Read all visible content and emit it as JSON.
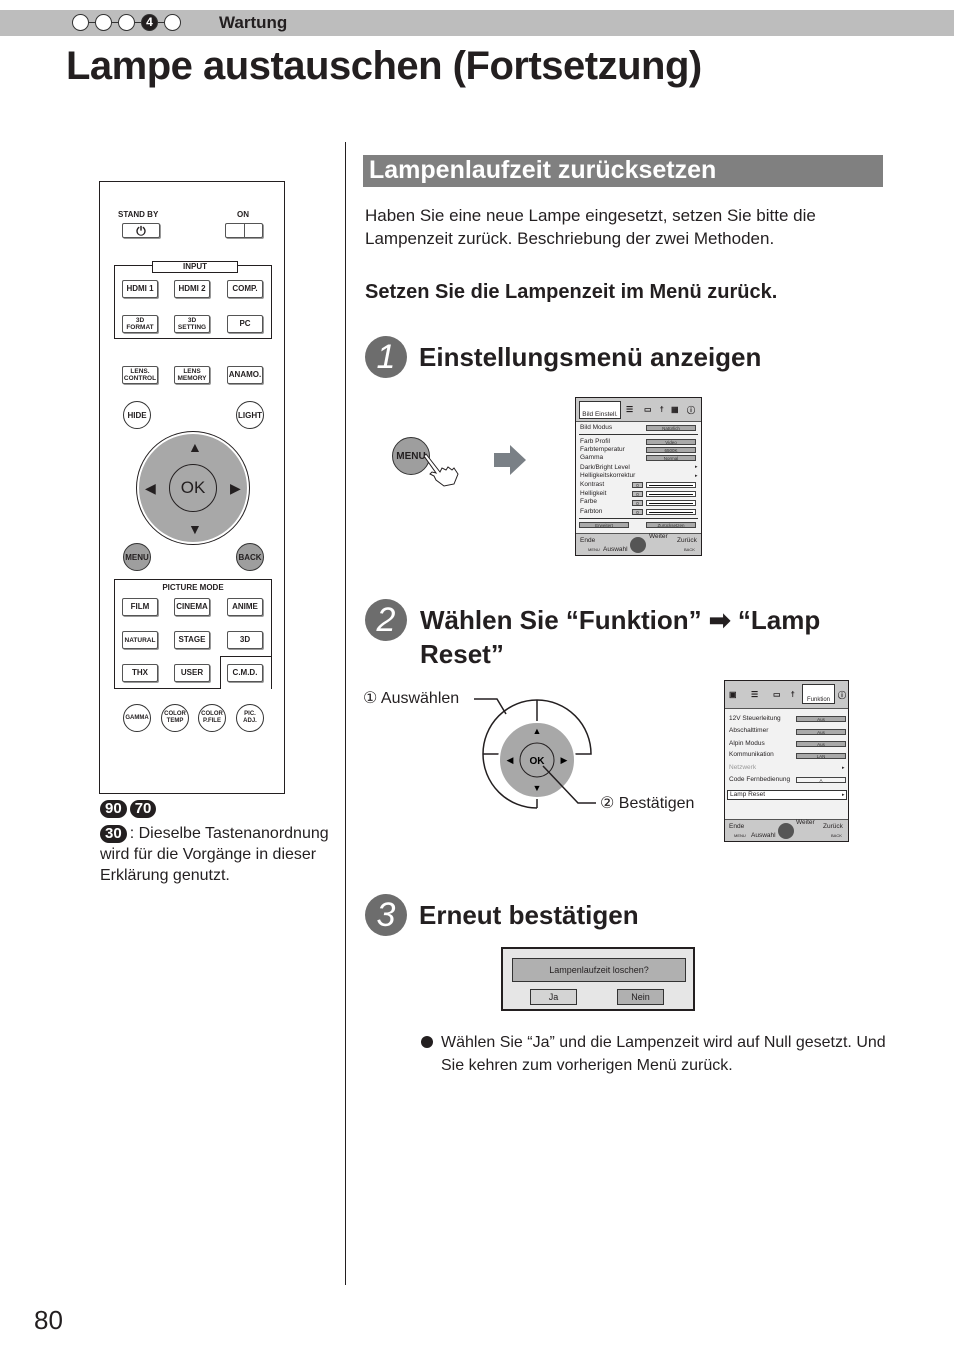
{
  "header": {
    "chapter_steps": [
      "",
      "",
      "",
      "4",
      ""
    ],
    "active_step": 4,
    "chapter_label": "Wartung",
    "page_title": "Lampe austauschen (Fortsetzung)"
  },
  "remote": {
    "standby_label": "STAND BY",
    "on_label": "ON",
    "input_group_label": "INPUT",
    "input_buttons": [
      "HDMI 1",
      "HDMI 2",
      "COMP.",
      "PC"
    ],
    "threed_format": [
      "3D",
      "FORMAT"
    ],
    "threed_setting": [
      "3D",
      "SETTING"
    ],
    "lens_control": [
      "LENS.",
      "CONTROL"
    ],
    "lens_memory": [
      "LENS",
      "MEMORY"
    ],
    "anamo": "ANAMO.",
    "hide": "HIDE",
    "light": "LIGHT",
    "ok": "OK",
    "menu": "MENU",
    "back": "BACK",
    "picture_mode_label": "PICTURE MODE",
    "picture_mode_buttons": [
      "FILM",
      "CINEMA",
      "ANIME",
      "NATURAL",
      "STAGE",
      "3D",
      "THX",
      "USER",
      "C.M.D."
    ],
    "round_buttons": [
      [
        "GAMMA",
        ""
      ],
      [
        "COLOR",
        "TEMP"
      ],
      [
        "COLOR",
        "P.FILE"
      ],
      [
        "PIC.",
        "ADJ."
      ]
    ]
  },
  "note": {
    "badges": [
      "90",
      "70",
      "30"
    ],
    "text": ": Dieselbe Tastenanordnung wird für die Vorgänge in dieser Erklärung genutzt."
  },
  "section": {
    "heading": "Lampenlaufzeit zurücksetzen",
    "intro": "Haben Sie eine neue Lampe eingesetzt, setzen Sie bitte die Lampenzeit zurück. Beschriebung der zwei Methoden.",
    "subheading": "Setzen Sie die Lampenzeit im Menü zurück."
  },
  "steps": [
    {
      "number": "1",
      "title": "Einstellungsmenü anzeigen"
    },
    {
      "number": "2",
      "title": "Wählen Sie “Funktion” ➡ “Lamp Reset”"
    },
    {
      "number": "3",
      "title": "Erneut bestätigen"
    }
  ],
  "step1": {
    "menu_button": "MENU",
    "osd": {
      "active_tab": "Bild Einstell.",
      "rows": [
        {
          "label": "Bild Modus",
          "value": "Natürlich"
        },
        {
          "label": "Farb Profil",
          "value": "Video"
        },
        {
          "label": "Farbtemperatur",
          "value": "6500K"
        },
        {
          "label": "Gamma",
          "value": "Normal"
        },
        {
          "label": "Dark/Bright Level",
          "value": "▸"
        },
        {
          "label": "Helligkeitskorrektur",
          "value": "▸"
        },
        {
          "label": "Kontrast",
          "value": "0"
        },
        {
          "label": "Helligkeit",
          "value": "0"
        },
        {
          "label": "Farbe",
          "value": "0"
        },
        {
          "label": "Farbton",
          "value": "0"
        }
      ],
      "buttons": [
        "Erweitert",
        "Zurücksetzen"
      ],
      "footer": {
        "end": "Ende",
        "end_key": "MENU",
        "select": "Auswahl",
        "next": "Weiter",
        "back": "Zurück",
        "back_key": "BACK"
      }
    }
  },
  "step2": {
    "select_label": "① Auswählen",
    "confirm_label": "② Bestätigen",
    "ok": "OK",
    "osd": {
      "active_tab": "Funktion",
      "rows": [
        {
          "label": "12V Steuerleitung",
          "value": "Aus"
        },
        {
          "label": "Abschalttimer",
          "value": "Aus"
        },
        {
          "label": "Alpin Modus",
          "value": "Aus"
        },
        {
          "label": "Kommunikation",
          "value": "LAN"
        },
        {
          "label": "Netzwerk",
          "value": "▸"
        },
        {
          "label": "Code Fernbedienung",
          "value": "A"
        },
        {
          "label": "Lamp Reset",
          "value": "▸"
        }
      ],
      "footer": {
        "end": "Ende",
        "end_key": "MENU",
        "select": "Auswahl",
        "next": "Weiter",
        "back": "Zurück",
        "back_key": "BACK"
      }
    }
  },
  "step3": {
    "dialog_message": "Lampenlaufzeit loschen?",
    "yes": "Ja",
    "no": "Nein",
    "bullet": "Wählen Sie “Ja” und die Lampenzeit wird auf Null gesetzt. Und Sie kehren zum vorherigen Menü zurück."
  },
  "page_number": "80"
}
